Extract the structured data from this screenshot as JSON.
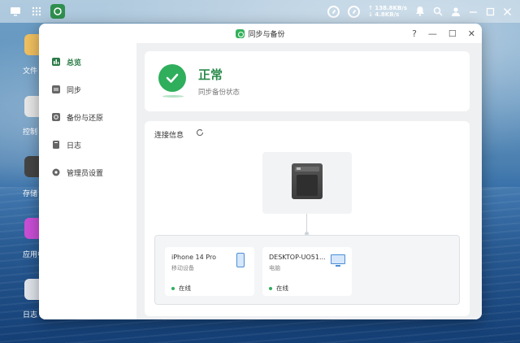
{
  "desktop": {
    "icons": [
      {
        "label": "文件",
        "color": "#f0c060"
      },
      {
        "label": "控制",
        "color": "#e6e6e6"
      },
      {
        "label": "存储",
        "color": "#444444"
      },
      {
        "label": "应用中",
        "color": "#c94fd6"
      },
      {
        "label": "日志",
        "color": "#dfe4ea"
      }
    ]
  },
  "topbar": {
    "upload_speed": "138.8KB/s",
    "download_speed": "4.8KB/s",
    "icons": [
      "desktop-icon",
      "grid-icon",
      "sync-app-icon",
      "gauge-icon",
      "gauge-icon",
      "bell-icon",
      "search-icon",
      "user-icon",
      "minimize-icon",
      "maximize-icon",
      "close-icon"
    ]
  },
  "window": {
    "title": "同步与备份",
    "controls": {
      "help": "?",
      "minimize": "—",
      "maximize": "☐",
      "close": "✕"
    }
  },
  "sidebar": {
    "items": [
      {
        "label": "总览",
        "icon": "overview-icon",
        "active": true
      },
      {
        "label": "同步",
        "icon": "sync-icon",
        "active": false
      },
      {
        "label": "备份与还原",
        "icon": "backup-icon",
        "active": false
      },
      {
        "label": "日志",
        "icon": "log-icon",
        "active": false
      },
      {
        "label": "管理员设置",
        "icon": "gear-icon",
        "active": false
      }
    ]
  },
  "status": {
    "title": "正常",
    "subtitle": "同步备份状态",
    "color": "#2fae5c"
  },
  "connection": {
    "title": "连接信息",
    "devices": [
      {
        "name": "iPhone 14 Pro",
        "type": "移动设备",
        "status": "在线",
        "icon": "phone-icon"
      },
      {
        "name": "DESKTOP-UO51...",
        "type": "电脑",
        "status": "在线",
        "icon": "monitor-icon"
      }
    ]
  }
}
